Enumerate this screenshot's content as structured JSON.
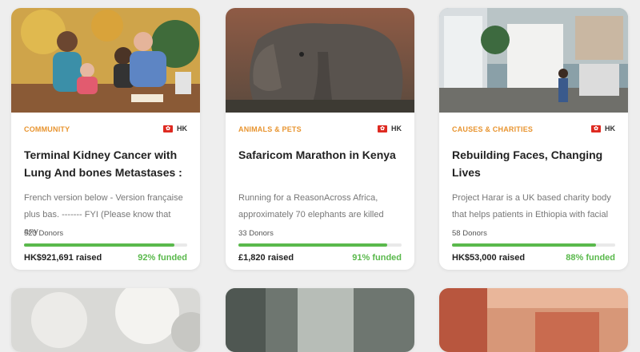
{
  "cards": [
    {
      "category": "COMMUNITY",
      "country": "HK",
      "title": "Terminal Kidney Cancer with Lung And bones Metastases :",
      "description": "French version below - Version française plus bas. ------- FYI (Please know that any",
      "donors": "523 Donors",
      "raised": "HK$921,691 raised",
      "funded": "92% funded",
      "progress": 0.92
    },
    {
      "category": "ANIMALS & PETS",
      "country": "HK",
      "title": "Safaricom Marathon in Kenya",
      "description": "Running for a ReasonAcross Africa, approximately 70 elephants are killed",
      "donors": "33 Donors",
      "raised": "£1,820 raised",
      "funded": "91% funded",
      "progress": 0.91
    },
    {
      "category": "CAUSES & CHARITIES",
      "country": "HK",
      "title": "Rebuilding Faces, Changing Lives",
      "description": "Project Harar is a UK based charity body that helps patients in Ethiopia with facial",
      "donors": "58 Donors",
      "raised": "HK$53,000 raised",
      "funded": "88% funded",
      "progress": 0.88
    }
  ],
  "colors": {
    "accent": "#e8942f",
    "progress": "#5ab94c",
    "flag": "#de2a21"
  }
}
